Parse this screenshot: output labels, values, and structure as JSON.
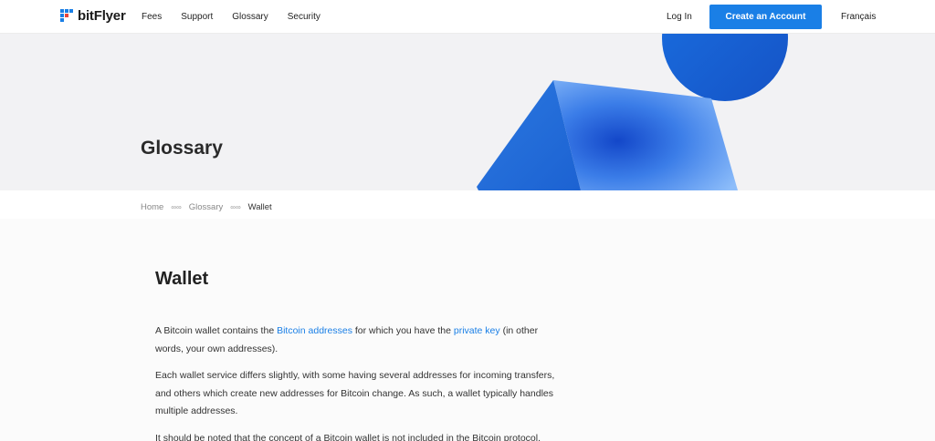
{
  "header": {
    "brand": "bitFlyer",
    "nav": [
      "Fees",
      "Support",
      "Glossary",
      "Security"
    ],
    "login": "Log In",
    "cta": "Create an Account",
    "language": "Français"
  },
  "hero": {
    "title": "Glossary"
  },
  "breadcrumb": {
    "home": "Home",
    "section": "Glossary",
    "current": "Wallet",
    "separator": "∞∞"
  },
  "article": {
    "title": "Wallet",
    "p1": {
      "t1": "A Bitcoin wallet contains the ",
      "link1": "Bitcoin addresses",
      "t2": " for which you have the ",
      "link2": "private key",
      "t3": " (in other words, your own addresses)."
    },
    "p2": "Each wallet service differs slightly, with some having several addresses for incoming transfers, and others which create new addresses for Bitcoin change. As such, a wallet typically handles multiple addresses.",
    "p3": "It should be noted that the concept of a Bitcoin wallet is not included in the Bitcoin protocol."
  },
  "colors": {
    "accent": "#1a7fe6",
    "logo_blue": "#1a7fe6",
    "logo_red": "#e8443a"
  }
}
